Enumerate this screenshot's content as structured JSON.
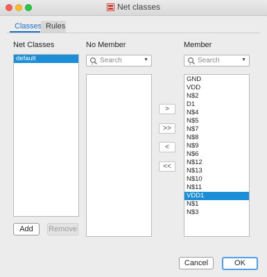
{
  "window": {
    "title": "Net classes"
  },
  "tabs": [
    {
      "label": "Classes",
      "selected": true
    },
    {
      "label": "Rules",
      "selected": false
    }
  ],
  "net_classes": {
    "heading": "Net Classes",
    "items": [
      {
        "label": "default",
        "selected": true
      }
    ],
    "add_label": "Add",
    "remove_label": "Remove"
  },
  "no_member": {
    "heading": "No Member",
    "search_placeholder": "Search",
    "items": []
  },
  "member": {
    "heading": "Member",
    "search_placeholder": "Search",
    "items": [
      {
        "label": "GND",
        "selected": false
      },
      {
        "label": "VDD",
        "selected": false
      },
      {
        "label": "N$2",
        "selected": false
      },
      {
        "label": "D1",
        "selected": false
      },
      {
        "label": "N$4",
        "selected": false
      },
      {
        "label": "N$5",
        "selected": false
      },
      {
        "label": "N$7",
        "selected": false
      },
      {
        "label": "N$8",
        "selected": false
      },
      {
        "label": "N$9",
        "selected": false
      },
      {
        "label": "N$6",
        "selected": false
      },
      {
        "label": "N$12",
        "selected": false
      },
      {
        "label": "N$13",
        "selected": false
      },
      {
        "label": "N$10",
        "selected": false
      },
      {
        "label": "N$11",
        "selected": false
      },
      {
        "label": "VDD1",
        "selected": true
      },
      {
        "label": "N$1",
        "selected": false
      },
      {
        "label": "N$3",
        "selected": false
      }
    ]
  },
  "move_buttons": {
    "move_right": ">",
    "move_all_right": ">>",
    "move_left": "<",
    "move_all_left": "<<"
  },
  "footer": {
    "cancel_label": "Cancel",
    "ok_label": "OK"
  },
  "colors": {
    "accent": "#1a6fc9",
    "selection": "#1b8ed7",
    "default_button_border": "#4c9cf0"
  }
}
